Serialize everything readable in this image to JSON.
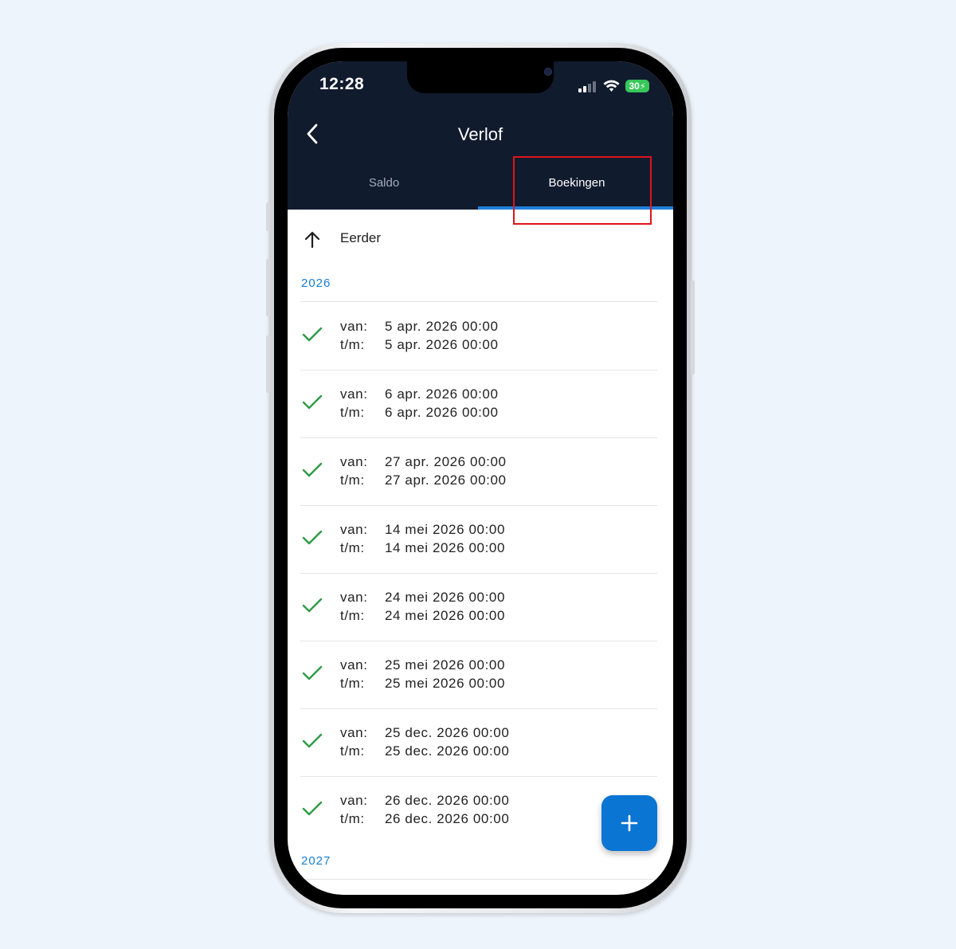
{
  "status_bar": {
    "time": "12:28",
    "battery": "30"
  },
  "header": {
    "title": "Verlof"
  },
  "tabs": [
    {
      "label": "Saldo",
      "active": false
    },
    {
      "label": "Boekingen",
      "active": true
    }
  ],
  "earlier": {
    "label": "Eerder"
  },
  "labels": {
    "from": "van:",
    "to": "t/m:"
  },
  "groups": [
    {
      "year": "2026",
      "bookings": [
        {
          "from": "5 apr. 2026 00:00",
          "to": "5 apr. 2026 00:00"
        },
        {
          "from": "6 apr. 2026 00:00",
          "to": "6 apr. 2026 00:00"
        },
        {
          "from": "27 apr. 2026 00:00",
          "to": "27 apr. 2026 00:00"
        },
        {
          "from": "14 mei 2026 00:00",
          "to": "14 mei 2026 00:00"
        },
        {
          "from": "24 mei 2026 00:00",
          "to": "24 mei 2026 00:00"
        },
        {
          "from": "25 mei 2026 00:00",
          "to": "25 mei 2026 00:00"
        },
        {
          "from": "25 dec. 2026 00:00",
          "to": "25 dec. 2026 00:00"
        },
        {
          "from": "26 dec. 2026 00:00",
          "to": "26 dec. 2026 00:00"
        }
      ]
    },
    {
      "year": "2027",
      "bookings": []
    }
  ],
  "colors": {
    "header_bg": "#111b2e",
    "accent": "#1f7fdb",
    "check": "#2e9b45",
    "fab": "#0b75d4",
    "highlight": "#e0141c"
  },
  "icons": {
    "back": "chevron-left-icon",
    "earlier": "arrow-up-icon",
    "approved": "check-icon",
    "add": "plus-icon"
  }
}
